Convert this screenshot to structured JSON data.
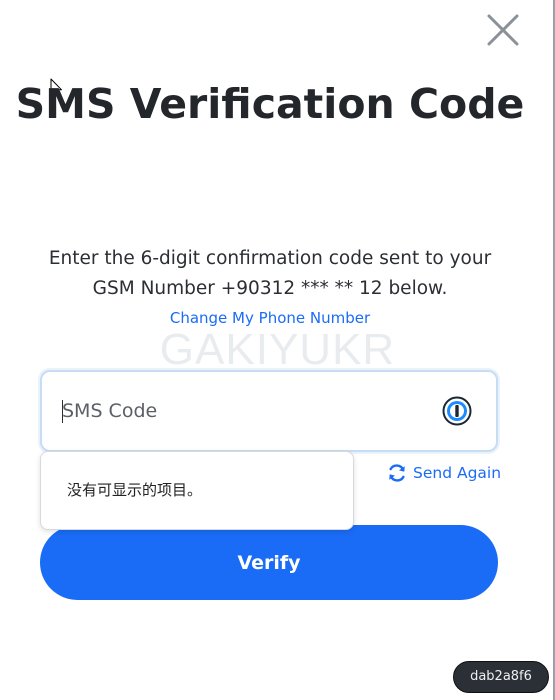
{
  "dialog": {
    "title": "SMS Verification Code",
    "description": "Enter the 6-digit confirmation code sent to your GSM Number +90312 *** ** 12 below.",
    "change_phone_link": "Change My Phone Number",
    "watermark": "GAKIYUKR"
  },
  "code_input": {
    "value": "",
    "placeholder": "SMS Code",
    "password_manager_icon": "1password-icon"
  },
  "autofill_dropdown": {
    "message": "没有可显示的项目。"
  },
  "send_again": {
    "label": "Send Again",
    "icon": "refresh-icon"
  },
  "verify_button": {
    "label": "Verify"
  },
  "badge": {
    "text": "dab2a8f6"
  },
  "colors": {
    "accent": "#1a6cf6",
    "title": "#23262b",
    "close_icon": "#8a9199"
  },
  "icons": {
    "close": "close-icon",
    "cursor": "mouse-cursor-icon"
  }
}
